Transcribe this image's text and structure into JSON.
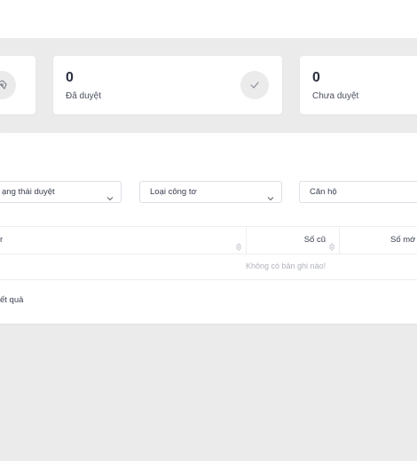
{
  "stats": [
    {
      "value": "",
      "label": "",
      "icon": "pen-tool-icon"
    },
    {
      "value": "0",
      "label": "Đã duyệt",
      "icon": "check-icon"
    },
    {
      "value": "0",
      "label": "Chưa duyệt",
      "icon": ""
    }
  ],
  "filters": {
    "status_value": "ạng thái duyệt",
    "meter_type_value": "Loại công tơ",
    "apartment_value": "Căn hộ"
  },
  "table": {
    "columns": [
      "r",
      "Số cũ",
      "Số mớ"
    ],
    "empty_message": "Không có bản ghi nào!"
  },
  "footer": {
    "result_text": "ết quả"
  },
  "colors": {
    "page_background": "#ebebeb",
    "card_background": "#ffffff",
    "icon_circle": "#ebebeb",
    "muted_text": "#b0b3bc"
  }
}
